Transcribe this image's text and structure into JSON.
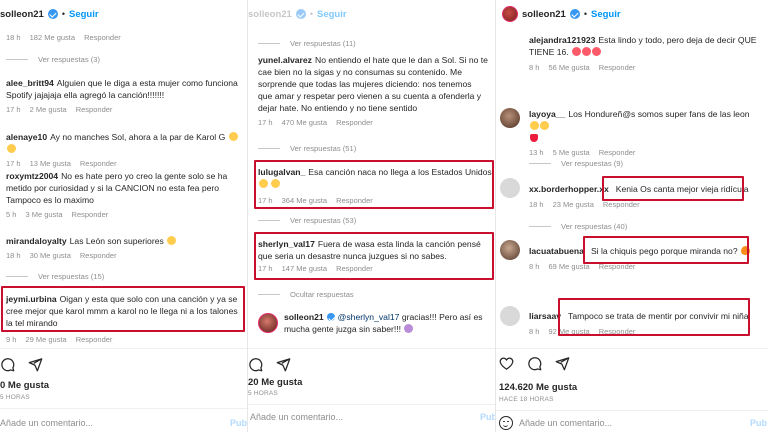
{
  "panel1": {
    "header": {
      "username": "solleon21",
      "follow": "Seguir"
    },
    "top_meta": {
      "time": "18 h",
      "likes": "182 Me gusta",
      "reply": "Responder"
    },
    "view_replies_1": "Ver respuestas (3)",
    "comments": [
      {
        "user": "alee_britt94",
        "text": "Alguien que le diga a esta mujer como funciona Spotify jajajaja ella agregó la canción!!!!!!!",
        "time": "17 h",
        "likes": "2 Me gusta",
        "reply": "Responder"
      },
      {
        "user": "alenaye10",
        "text": "Ay no manches Sol, ahora a la par de Karol G",
        "time": "17 h",
        "likes": "13 Me gusta",
        "reply": "Responder"
      },
      {
        "user": "roxymtz2004",
        "text": "No es hate pero yo creo la gente solo se ha metido por curiosidad y si la CANCION no esta fea pero Tampoco es lo maximo",
        "time": "5 h",
        "likes": "3 Me gusta",
        "reply": "Responder"
      },
      {
        "user": "mirandaloyalty",
        "text": "Las León son superiores",
        "time": "18 h",
        "likes": "30 Me gusta",
        "reply": "Responder"
      }
    ],
    "view_replies_2": "Ver respuestas (15)",
    "highlight": {
      "user": "jeymi.urbina",
      "text": "Oigan y esta que solo con una canción y ya se cree mejor que karol mmm a karol no le llega ni a los talones la tel mirando",
      "time": "9 h",
      "likes": "29 Me gusta",
      "reply": "Responder"
    },
    "likes_total": "0 Me gusta",
    "ago": "5 HORAS",
    "add_comment": "Añade un comentario...",
    "publish": "Pub"
  },
  "panel2": {
    "view_replies_top": "Ver respuestas (11)",
    "comments": [
      {
        "user": "yunel.alvarez",
        "text": "No entiendo el hate que le dan a Sol. Si no te cae bien no la sigas y no consumas su contenido. Me sorprende que todas las mujeres diciendo: nos tenemos que amar y respetar pero vienen a su cuenta a ofenderla y dejar hate. No entiendo y no tiene sentido",
        "time": "17 h",
        "likes": "470 Me gusta",
        "reply": "Responder"
      }
    ],
    "view_replies_mid": "Ver respuestas (51)",
    "highlight1": {
      "user": "lulugalvan_",
      "text": "Esa canción naca no llega a los Estados Unidos",
      "time": "17 h",
      "likes": "364 Me gusta",
      "reply": "Responder"
    },
    "view_replies_mid2": "Ver respuestas (53)",
    "highlight2": {
      "user": "sherlyn_val17",
      "text": "Fuera de wasa esta linda la canción pensé que seria un desastre nunca juzgues si no sabes.",
      "time": "17 h",
      "likes": "147 Me gusta",
      "reply": "Responder"
    },
    "hide_replies": "Ocultar respuestas",
    "reply_comment": {
      "user": "solleon21",
      "mention": "@sherlyn_val17",
      "text": "gracias!!! Pero así es mucha gente juzga sin saber!!!"
    },
    "likes_total": "20 Me gusta",
    "ago": "5 HORAS",
    "add_comment": "Añade un comentario...",
    "publish": "Pub"
  },
  "panel3": {
    "header": {
      "username": "solleon21",
      "follow": "Seguir"
    },
    "comments": [
      {
        "user": "alejandra121923",
        "text": "Esta lindo y todo, pero deja de decir QUE TIENE 16.",
        "time": "8 h",
        "likes": "56 Me gusta",
        "reply": "Responder"
      },
      {
        "user": "layoya__",
        "text": "Los Hondureñ@s somos super fans de las leon",
        "time": "13 h",
        "likes": "5 Me gusta",
        "reply": "Responder"
      }
    ],
    "view_replies_a": "Ver respuestas (9)",
    "highlight1": {
      "user": "xx.borderhopper.xx",
      "text": "Kenia Os canta mejor vieja ridícula",
      "time": "18 h",
      "likes": "23 Me gusta",
      "reply": "Responder"
    },
    "view_replies_b": "Ver respuestas (40)",
    "highlight2": {
      "user": "lacuatabuena",
      "text": "Si la chiquis pego porque miranda no?",
      "time": "8 h",
      "likes": "69 Me gusta",
      "reply": "Responder"
    },
    "highlight3": {
      "user": "liarsaav",
      "text": "Tampoco se trata de mentir por convivir mi niña",
      "time": "8 h",
      "likes": "92 Me gusta",
      "reply": "Responder"
    },
    "likes_total": "124.620 Me gusta",
    "ago": "HACE 18 HORAS",
    "add_comment": "Añade un comentario...",
    "publish": "Pub"
  },
  "colors": {
    "accent": "#0095f6",
    "highlight_border": "#c8102e",
    "muted": "#8e8e8e"
  },
  "icons": [
    "heart-icon",
    "comment-icon",
    "share-icon",
    "smile-icon",
    "verified-badge"
  ]
}
